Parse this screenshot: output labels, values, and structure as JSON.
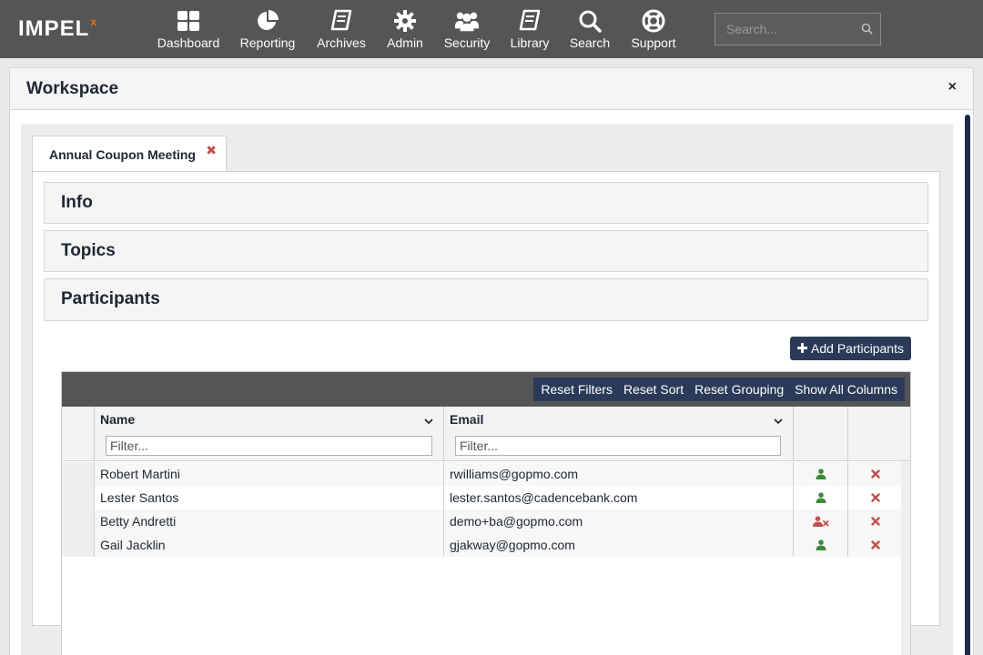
{
  "brand": {
    "name": "IMPEL",
    "superscript": "x",
    "accent_color": "#e8741e"
  },
  "nav": [
    {
      "label": "Dashboard",
      "icon": "dashboard-icon"
    },
    {
      "label": "Reporting",
      "icon": "pie-chart-icon"
    },
    {
      "label": "Archives",
      "icon": "book-icon"
    },
    {
      "label": "Admin",
      "icon": "gear-icon"
    },
    {
      "label": "Security",
      "icon": "users-icon"
    },
    {
      "label": "Library",
      "icon": "book-icon"
    },
    {
      "label": "Search",
      "icon": "search-icon"
    },
    {
      "label": "Support",
      "icon": "life-ring-icon"
    }
  ],
  "search": {
    "placeholder": "Search..."
  },
  "workspace": {
    "title": "Workspace",
    "close": "×"
  },
  "tab": {
    "label": "Annual Coupon Meeting",
    "close": "✖"
  },
  "sections": {
    "info": "Info",
    "topics": "Topics",
    "participants": "Participants"
  },
  "add_button": {
    "label": "Add Participants",
    "icon": "plus-icon"
  },
  "toolbar": {
    "reset_filters": "Reset Filters",
    "reset_sort": "Reset Sort",
    "reset_grouping": "Reset Grouping",
    "show_all_columns": "Show All Columns"
  },
  "grid": {
    "columns": {
      "name": "Name",
      "email": "Email"
    },
    "filter_placeholder": "Filter...",
    "rows": [
      {
        "name": "Robert Martini",
        "email": "rwilliams@gopmo.com",
        "status": "user-icon"
      },
      {
        "name": "Lester Santos",
        "email": "lester.santos@cadencebank.com",
        "status": "user-icon"
      },
      {
        "name": "Betty Andretti",
        "email": "demo+ba@gopmo.com",
        "status": "user-remove-icon"
      },
      {
        "name": "Gail Jacklin",
        "email": "gjakway@gopmo.com",
        "status": "user-icon"
      }
    ]
  },
  "colors": {
    "navbar": "#555555",
    "primary_button": "#2b3a59",
    "user_green": "#3a8a3a",
    "remove_red": "#c0504d"
  }
}
